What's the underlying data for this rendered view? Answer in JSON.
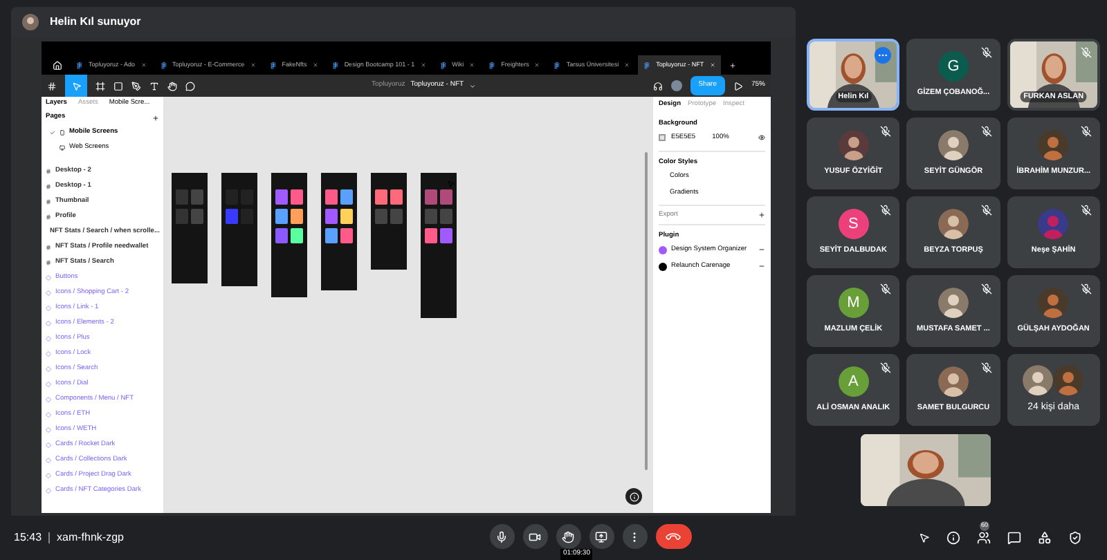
{
  "presenter": {
    "label": "Helin Kıl sunuyor"
  },
  "figma": {
    "tabs": [
      {
        "label": "Topluyoruz - Ado",
        "selected": false
      },
      {
        "label": "Topluyoruz - E-Commerce",
        "selected": false
      },
      {
        "label": "FakeNfts",
        "selected": false
      },
      {
        "label": "Design Bootcamp 101 - 1",
        "selected": false
      },
      {
        "label": "Wiki",
        "selected": false
      },
      {
        "label": "Freighters",
        "selected": false
      },
      {
        "label": "Tarsus Üniversitesi",
        "selected": false
      },
      {
        "label": "Topluyoruz - NFT",
        "selected": true
      }
    ],
    "breadcrumb": {
      "team": "Topluyoruz",
      "file": "Topluyoruz - NFT"
    },
    "share": "Share",
    "zoom": "75%",
    "left_tabs": [
      {
        "label": "Layers",
        "selected": true
      },
      {
        "label": "Assets",
        "selected": false
      }
    ],
    "page_switcher": "Mobile Scre...",
    "pages_heading": "Pages",
    "pages": [
      {
        "label": "Mobile Screens",
        "selected": true
      },
      {
        "label": "Web Screens",
        "selected": false
      }
    ],
    "layers": [
      {
        "label": "Desktop - 2",
        "kind": "frame"
      },
      {
        "label": "Desktop - 1",
        "kind": "frame"
      },
      {
        "label": "Thumbnail",
        "kind": "frame"
      },
      {
        "label": "Profile",
        "kind": "frame"
      },
      {
        "label": "NFT Stats / Search / when scrolle...",
        "kind": "frame"
      },
      {
        "label": "NFT Stats / Profile needwallet",
        "kind": "frame"
      },
      {
        "label": "NFT Stats / Search",
        "kind": "frame"
      },
      {
        "label": "Buttons",
        "kind": "component"
      },
      {
        "label": "Icons / Shopping Cart - 2",
        "kind": "component"
      },
      {
        "label": "Icons / Link - 1",
        "kind": "component"
      },
      {
        "label": "Icons / Elements - 2",
        "kind": "component"
      },
      {
        "label": "Icons / Plus",
        "kind": "component"
      },
      {
        "label": "Icons / Lock",
        "kind": "component"
      },
      {
        "label": "Icons / Search",
        "kind": "component"
      },
      {
        "label": "Icons / Dial",
        "kind": "component"
      },
      {
        "label": "Components / Menu / NFT",
        "kind": "component"
      },
      {
        "label": "Icons / ETH",
        "kind": "component"
      },
      {
        "label": "Icons / WETH",
        "kind": "component"
      },
      {
        "label": "Cards / Rocket Dark",
        "kind": "component"
      },
      {
        "label": "Cards / Collections Dark",
        "kind": "component"
      },
      {
        "label": "Cards / Project Drag Dark",
        "kind": "component"
      },
      {
        "label": "Cards / NFT Categories Dark",
        "kind": "component"
      }
    ],
    "right_tabs": [
      {
        "label": "Design",
        "selected": true
      },
      {
        "label": "Prototype",
        "selected": false
      },
      {
        "label": "Inspect",
        "selected": false
      }
    ],
    "background": {
      "heading": "Background",
      "hex": "E5E5E5",
      "opacity": "100%"
    },
    "color_styles": {
      "heading": "Color Styles",
      "items": [
        "Colors",
        "Gradients"
      ]
    },
    "export": "Export",
    "plugins": {
      "heading": "Plugin",
      "items": [
        {
          "label": "Design System Organizer",
          "color": "#a259ff"
        },
        {
          "label": "Relaunch Carenage",
          "color": "#000000"
        }
      ]
    }
  },
  "participants": [
    {
      "name": "Helin Kıl",
      "kind": "video",
      "muted": false,
      "pinned": true
    },
    {
      "name": "GİZEM ÇOBANOĞ...",
      "kind": "letter",
      "letter": "G",
      "color": "#0b5b4f",
      "muted": true,
      "pinned": false
    },
    {
      "name": "FURKAN ASLAN",
      "kind": "video",
      "muted": true,
      "pinned": false
    },
    {
      "name": "YUSUF ÖZYİĞİT",
      "muted": true,
      "pinned": false
    },
    {
      "name": "SEYİT GÜNGÖR",
      "muted": true,
      "pinned": false
    },
    {
      "name": "İBRAHİM MUNZUR...",
      "muted": true,
      "pinned": false
    },
    {
      "name": "SEYİT DALBUDAK",
      "kind": "letter",
      "letter": "S",
      "color": "#ec407a",
      "muted": true,
      "pinned": false
    },
    {
      "name": "BEYZA TORPUŞ",
      "muted": true,
      "pinned": false
    },
    {
      "name": "Neşe ŞAHİN",
      "muted": true,
      "pinned": false
    },
    {
      "name": "MAZLUM ÇELİK",
      "kind": "letter",
      "letter": "M",
      "color": "#689f38",
      "muted": true,
      "pinned": false
    },
    {
      "name": "MUSTAFA SAMET ...",
      "muted": true,
      "pinned": false
    },
    {
      "name": "GÜLŞAH AYDOĞAN",
      "muted": true,
      "pinned": false
    },
    {
      "name": "ALİ OSMAN ANALIK",
      "kind": "letter",
      "letter": "A",
      "color": "#689f38",
      "muted": true,
      "pinned": false
    },
    {
      "name": "SAMET BULGURCU",
      "muted": true,
      "pinned": false
    },
    {
      "name": "24 kişi daha",
      "kind": "more",
      "muted": false,
      "pinned": false
    }
  ],
  "bottom_bar": {
    "time": "15:43",
    "meeting_code": "xam-fhnk-zgp",
    "timer": "01:09:30",
    "people_count": "60"
  }
}
